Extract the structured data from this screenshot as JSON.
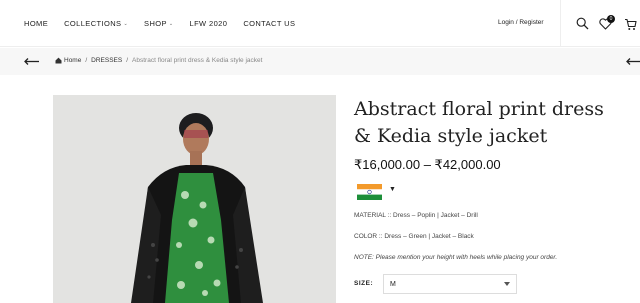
{
  "nav": {
    "items": [
      {
        "label": "HOME"
      },
      {
        "label": "COLLECTIONS"
      },
      {
        "label": "SHOP"
      },
      {
        "label": "LFW 2020"
      },
      {
        "label": "CONTACT US"
      }
    ],
    "login_label": "Login / Register",
    "wishlist_count": "0"
  },
  "breadcrumb": {
    "home": "Home",
    "category": "DRESSES",
    "current": "Abstract floral print dress & Kedia style jacket"
  },
  "product": {
    "title": "Abstract floral print dress & Kedia style jacket",
    "price": "₹16,000.00 – ₹42,000.00",
    "material": "MATERIAL :: Dress – Poplin | Jacket – Drill",
    "color": "COLOR :: Dress – Green | Jacket – Black",
    "note": "NOTE: Please mention your height with heels while placing your order.",
    "size_label": "SIZE:",
    "size_value": "M"
  },
  "icons": [
    "back-arrow-icon",
    "search-icon",
    "heart-icon",
    "cart-icon",
    "home-icon",
    "india-flag-icon",
    "chevron-down-icon"
  ]
}
